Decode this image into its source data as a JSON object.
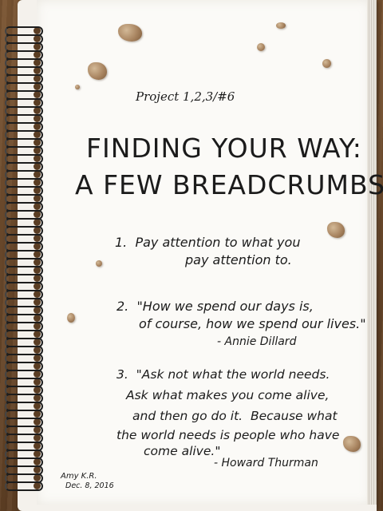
{
  "scene": {
    "subject": "handwritten notebook page",
    "colors": {
      "paper": "#fbfaf7",
      "ink": "#1b1b1b",
      "table": "#6b4a2c",
      "spiral": "#1d1d1d",
      "crumb": "#a98561"
    }
  },
  "note": {
    "project": "Project 1,2,3/#6",
    "title_line1": "FINDING YOUR WAY:",
    "title_line2": "A FEW BREADCRUMBS",
    "item1": {
      "line1": "1.  Pay attention to what you",
      "line2": "pay attention to."
    },
    "item2": {
      "line1": "2.  \"How we spend our days is,",
      "line2": "of course, how we spend our lives.\"",
      "attribution": "- Annie Dillard"
    },
    "item3": {
      "line1": "3.  \"Ask not what the world needs.",
      "line2": "Ask what makes you come alive,",
      "line3": "and then go do it.  Because what",
      "line4": "the world needs is people who have",
      "line5": "come alive.\"",
      "attribution": "- Howard Thurman"
    },
    "signature": {
      "name": "Amy K.R.",
      "date": "Dec. 8, 2016"
    }
  }
}
